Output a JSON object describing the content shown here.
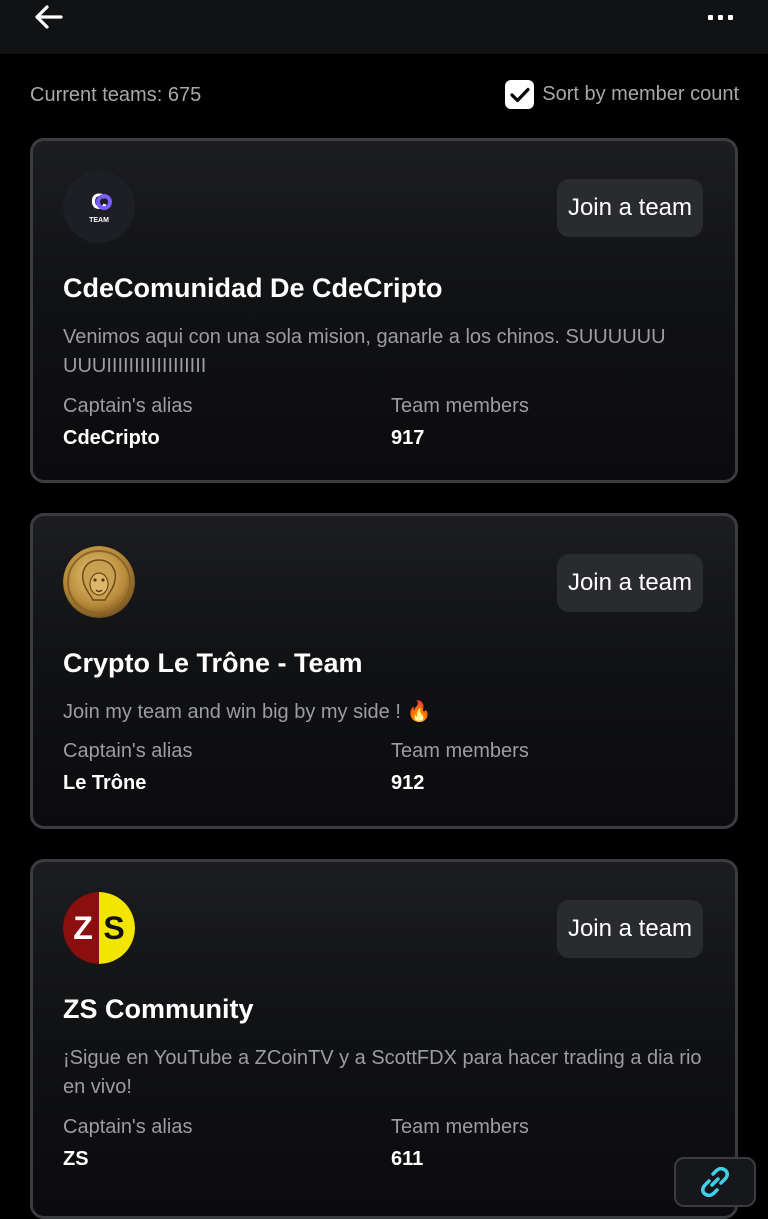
{
  "header": {
    "back_icon": "arrow-left-icon",
    "menu_icon": "more-horizontal-icon"
  },
  "meta": {
    "team_count_label": "Current teams: 675",
    "sort_label": "Sort by member count",
    "sort_checked": true
  },
  "teams": [
    {
      "logo_text": "CO",
      "logo_subtext": "TEAM",
      "join_label": "Join a team",
      "name": "CdeComunidad De CdeCripto",
      "description": "Venimos aqui con una sola mision, ganarle a los chinos. SUUUUUU UUUIIIIIIIIIIIIIIIIII",
      "captain_label": "Captain's alias",
      "captain": "CdeCripto",
      "members_label": "Team members",
      "members": "917"
    },
    {
      "logo_icon": "lion-coin-icon",
      "join_label": "Join a team",
      "name": "Crypto Le Trône - Team",
      "description": "Join my team and win big by my side ! 🔥",
      "captain_label": "Captain's alias",
      "captain": "Le Trône",
      "members_label": "Team members",
      "members": "912"
    },
    {
      "logo_text": "ZS",
      "join_label": "Join a team",
      "name": "ZS Community",
      "description": "¡Sigue en YouTube a ZCoinTV y a ScottFDX para hacer trading a dia rio en vivo!",
      "captain_label": "Captain's alias",
      "captain": "ZS",
      "members_label": "Team members",
      "members": "611"
    }
  ],
  "floating": {
    "icon": "link-icon"
  },
  "colors": {
    "background": "#000000",
    "card_border": "#3b3c3f",
    "button_bg": "#2a2b2f",
    "muted_text": "#9c9da0",
    "accent_cyan": "#3fd0e8"
  }
}
